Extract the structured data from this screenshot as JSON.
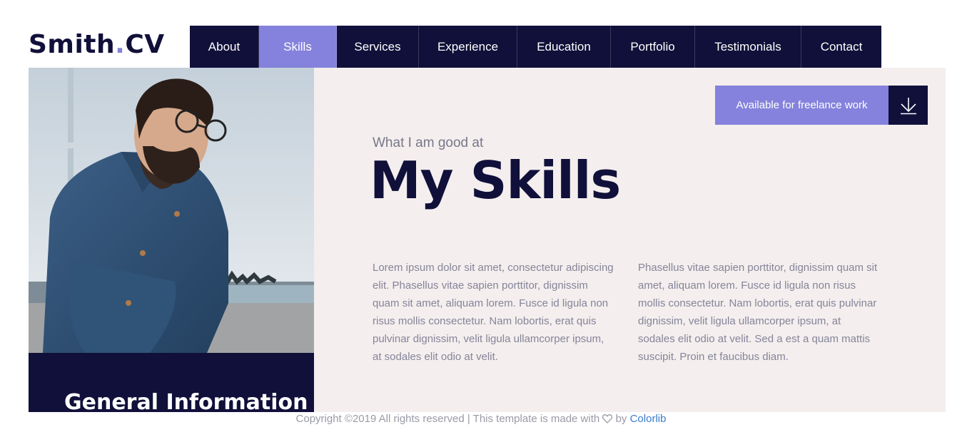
{
  "brand": {
    "name": "Smith",
    "dot": ".",
    "suffix": "CV",
    "accent": "#8482dc",
    "dark": "#10103a"
  },
  "nav": {
    "active": "Skills",
    "items": [
      {
        "label": "About"
      },
      {
        "label": "Skills"
      },
      {
        "label": "Services"
      },
      {
        "label": "Experience"
      },
      {
        "label": "Education"
      },
      {
        "label": "Portfolio"
      },
      {
        "label": "Testimonials"
      },
      {
        "label": "Contact"
      }
    ]
  },
  "sidebar": {
    "photo_icon": "profile-photo",
    "general_info_title": "General Information"
  },
  "freelance": {
    "label": "Available for freelance work",
    "icon": "download-arrow-icon"
  },
  "section": {
    "subtitle": "What I am good at",
    "title": "My Skills",
    "paragraph_1": "Lorem ipsum dolor sit amet, consectetur adipiscing elit. Phasellus vitae sapien porttitor, dignissim quam sit amet, aliquam lorem. Fusce id ligula non risus mollis consectetur. Nam lobortis, erat quis pulvinar dignissim, velit ligula ullamcorper ipsum, at sodales elit odio at velit.",
    "paragraph_2": "Phasellus vitae sapien porttitor, dignissim quam sit amet, aliquam lorem. Fusce id ligula non risus mollis consectetur. Nam lobortis, erat quis pulvinar dignissim, velit ligula ullamcorper ipsum, at sodales elit odio at velit. Sed a est a quam mattis suscipit. Proin et faucibus diam."
  },
  "footer": {
    "text_before": "Copyright ©2019 All rights reserved | This template is made with",
    "heart_icon": "heart-icon",
    "by": "by",
    "link_label": "Colorlib"
  }
}
